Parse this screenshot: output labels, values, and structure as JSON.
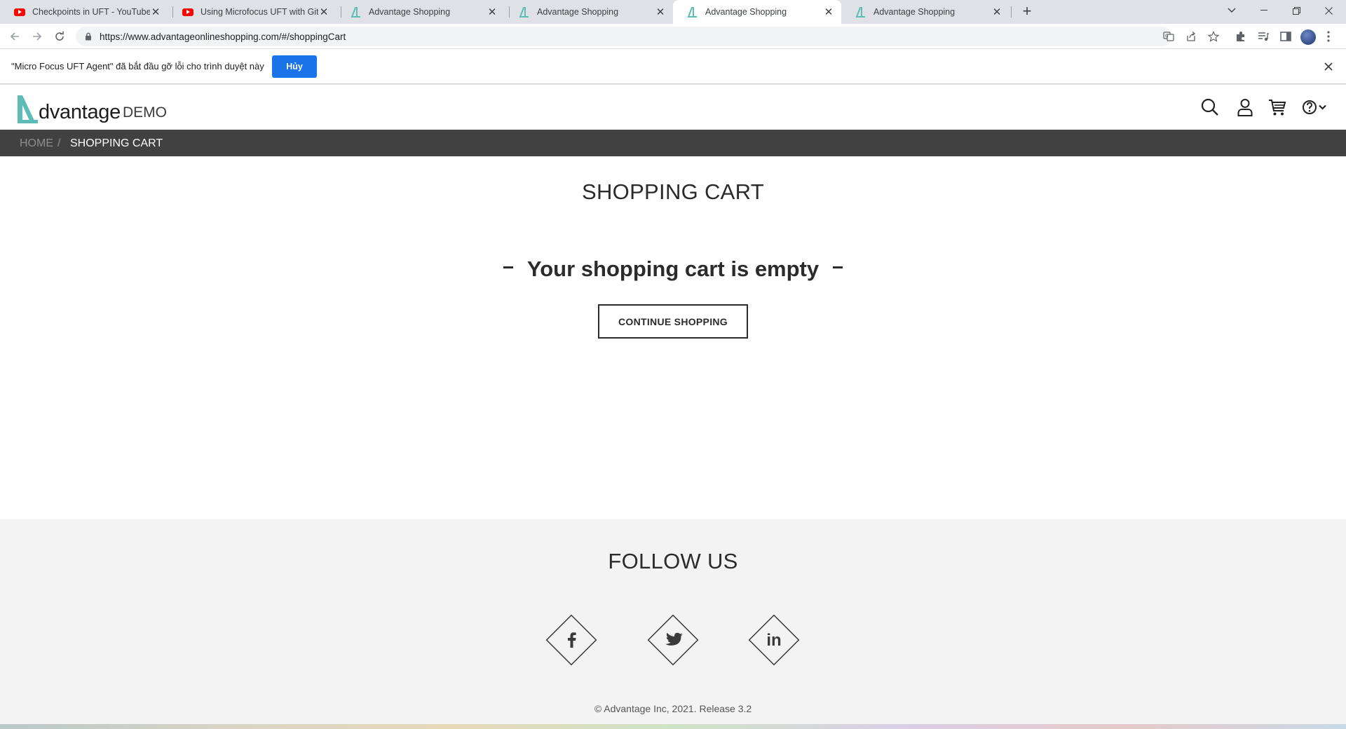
{
  "browser": {
    "tabs": [
      {
        "title": "Checkpoints in UFT - YouTube",
        "icon": "youtube-icon",
        "active": false
      },
      {
        "title": "Using Microfocus UFT with Git &",
        "icon": "youtube-icon",
        "active": false
      },
      {
        "title": "Advantage Shopping",
        "icon": "advantage-icon",
        "active": false
      },
      {
        "title": "Advantage Shopping",
        "icon": "advantage-icon",
        "active": false
      },
      {
        "title": "Advantage Shopping",
        "icon": "advantage-icon",
        "active": true
      },
      {
        "title": "Advantage Shopping",
        "icon": "advantage-icon",
        "active": false
      }
    ],
    "url": "https://www.advantageonlineshopping.com/#/shoppingCart"
  },
  "infobar": {
    "message": "\"Micro Focus UFT Agent\" đã bắt đầu gỡ lỗi cho trình duyệt này",
    "cancel_label": "Hủy"
  },
  "site": {
    "logo_word": "dvantage",
    "logo_demo": "DEMO",
    "accent_color": "#5dbcb6"
  },
  "breadcrumb": {
    "home": "HOME",
    "separator": "/",
    "current": "SHOPPING CART"
  },
  "main": {
    "title": "SHOPPING CART",
    "empty_message": "Your shopping cart is empty",
    "continue_label": "CONTINUE SHOPPING"
  },
  "footer": {
    "follow_title": "FOLLOW US",
    "social": [
      "facebook-icon",
      "twitter-icon",
      "linkedin-icon"
    ],
    "linkedin_text": "in",
    "copyright": "© Advantage Inc, 2021. Release 3.2"
  }
}
